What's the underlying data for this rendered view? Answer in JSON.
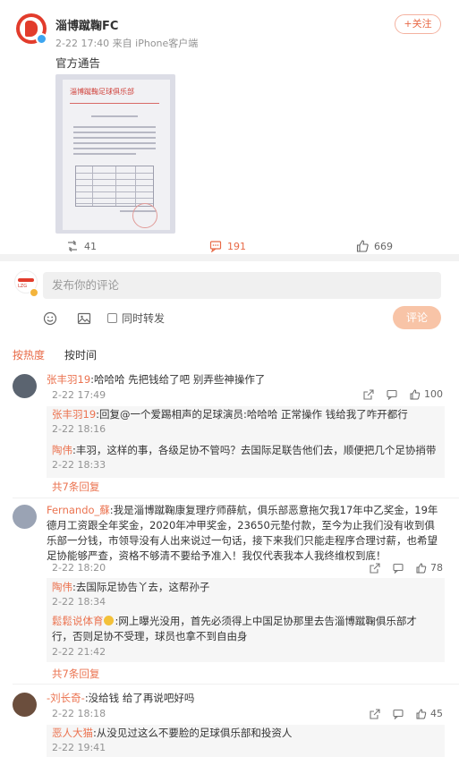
{
  "post": {
    "author": "淄博蹴鞠FC",
    "meta": "2-22 17:40  来自 iPhone客户端",
    "follow_label": "+关注",
    "text": "官方通告",
    "image": {
      "doc_title": "淄博蹴鞠足球俱乐部"
    },
    "actions": {
      "repost": "41",
      "comment": "191",
      "like": "669"
    }
  },
  "comment_box": {
    "placeholder": "发布你的评论",
    "repost_option": "同时转发",
    "submit_label": "评论"
  },
  "sort_tabs": {
    "hot": "按热度",
    "time": "按时间"
  },
  "comments": [
    {
      "name": "张丰羽19",
      "text": ":哈哈哈 先把钱给了吧 别弄些神操作了",
      "date": "2-22 17:49",
      "likes": "100",
      "replies": [
        {
          "name": "张丰羽19",
          "text": ":回复@一个爱踢相声的足球演员:哈哈哈 正常操作 钱给我了咋开都行",
          "date": "2-22 18:16"
        },
        {
          "name": "陶伟",
          "text": ":丰羽，这样的事，各级足协不管吗？去国际足联告他们去，顺便把几个足协捎带",
          "date": "2-22 18:33"
        }
      ],
      "more": "共7条回复"
    },
    {
      "name": "Fernando_蘇",
      "text": ":我是淄博蹴鞠康复理疗师薛航，俱乐部恶意拖欠我17年中乙奖金，19年德月工资跟全年奖金，2020年冲甲奖金，23650元垫付款，至今为止我们没有收到俱乐部一分钱，市领导没有人出来说过一句话，接下来我们只能走程序合理讨薪，也希望足协能够严查，资格不够清不要给予准入！我仅代表我本人我终维权到底！",
      "date": "2-22 18:20",
      "likes": "78",
      "replies": [
        {
          "name": "陶伟",
          "text": ":去国际足协告丫去，这帮孙子",
          "date": "2-22 18:34"
        },
        {
          "name": "鬆鬆说体育",
          "text": ":网上曝光没用，首先必须得上中国足协那里去告淄博蹴鞠俱乐部才行，否则足协不受理，球员也拿不到自由身",
          "date": "2-22 21:42"
        }
      ],
      "more": "共7条回复"
    },
    {
      "name": "-刘长奇-",
      "text": ":没给钱 给了再说吧好吗",
      "date": "2-22 18:18",
      "likes": "45",
      "replies": [
        {
          "name": "恶人大猫",
          "text": ":从没见过这么不要脸的足球俱乐部和投资人",
          "date": "2-22 19:41"
        }
      ]
    }
  ]
}
